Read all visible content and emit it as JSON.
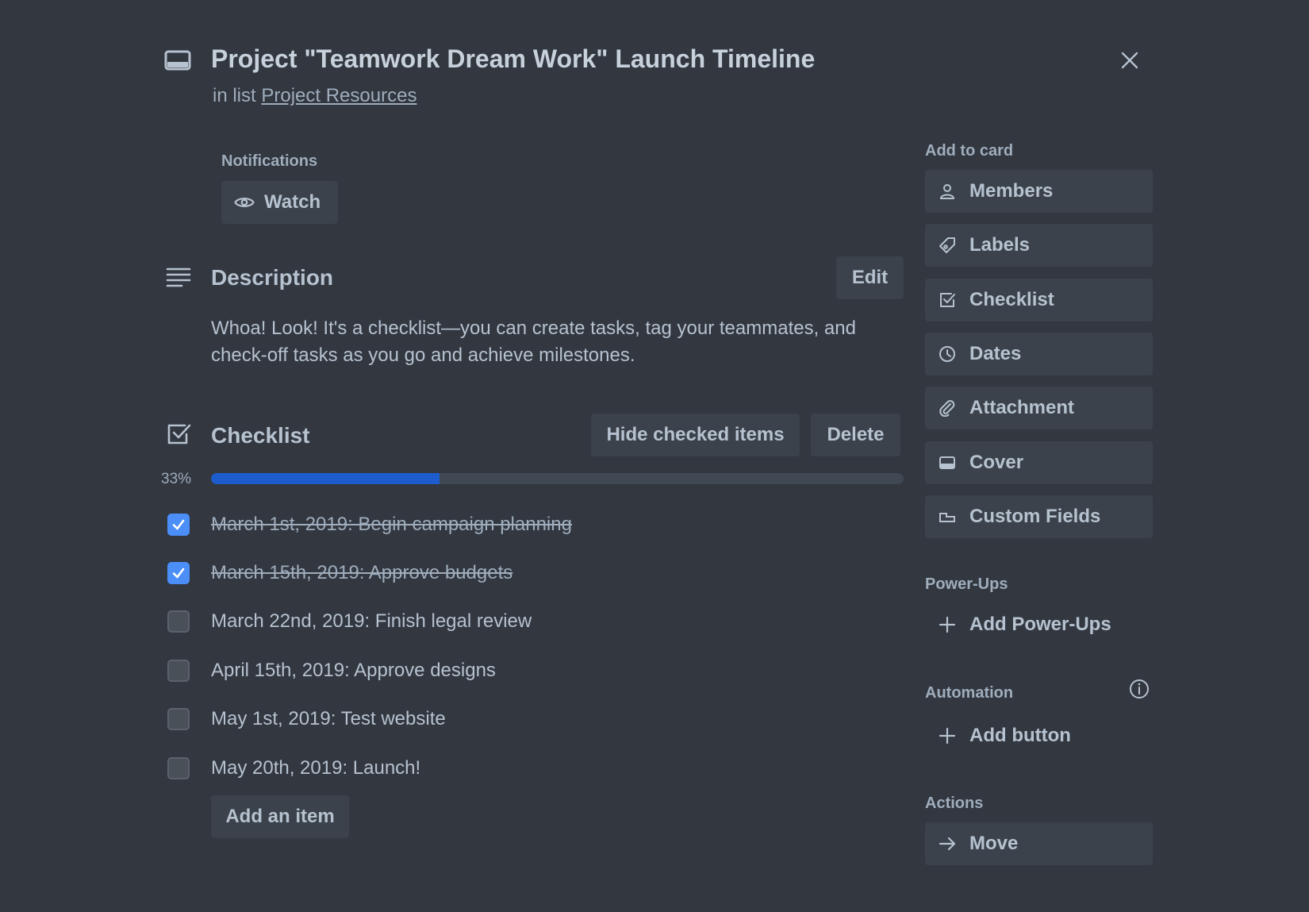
{
  "header": {
    "title": "Project \"Teamwork Dream Work\" Launch Timeline",
    "in_list_prefix": "in list",
    "list_name": "Project Resources"
  },
  "notifications": {
    "label": "Notifications",
    "watch_label": "Watch"
  },
  "description": {
    "title": "Description",
    "edit_label": "Edit",
    "text": "Whoa! Look! It's a checklist—you can create tasks, tag your teammates, and check-off tasks as you go and achieve milestones."
  },
  "checklist": {
    "title": "Checklist",
    "hide_checked_label": "Hide checked items",
    "delete_label": "Delete",
    "progress_label": "33%",
    "progress_fraction": 0.33,
    "items": [
      {
        "text": "March 1st, 2019: Begin campaign planning",
        "checked": true
      },
      {
        "text": "March 15th, 2019: Approve budgets",
        "checked": true
      },
      {
        "text": "March 22nd, 2019: Finish legal review",
        "checked": false
      },
      {
        "text": "April 15th, 2019: Approve designs",
        "checked": false
      },
      {
        "text": "May 1st, 2019: Test website",
        "checked": false
      },
      {
        "text": "May 20th, 2019: Launch!",
        "checked": false
      }
    ],
    "add_item_label": "Add an item"
  },
  "sidebar": {
    "add_to_card_label": "Add to card",
    "add_to_card": [
      {
        "label": "Members",
        "icon": "person-icon"
      },
      {
        "label": "Labels",
        "icon": "tag-icon"
      },
      {
        "label": "Checklist",
        "icon": "checkbox-icon"
      },
      {
        "label": "Dates",
        "icon": "clock-icon"
      },
      {
        "label": "Attachment",
        "icon": "paperclip-icon"
      },
      {
        "label": "Cover",
        "icon": "cover-icon"
      },
      {
        "label": "Custom Fields",
        "icon": "custom-field-icon"
      }
    ],
    "powerups_label": "Power-Ups",
    "add_powerups_label": "Add Power-Ups",
    "automation_label": "Automation",
    "add_button_label": "Add button",
    "actions_label": "Actions",
    "move_label": "Move"
  },
  "colors": {
    "background": "#323740",
    "button": "#3b424b",
    "accent": "#4c8ef7",
    "progress": "#1d5ccc"
  }
}
